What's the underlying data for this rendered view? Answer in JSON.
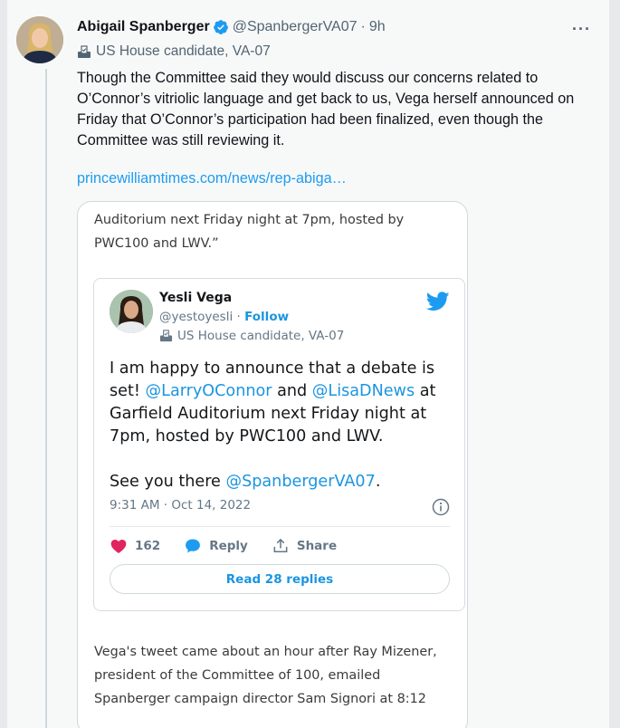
{
  "tweet": {
    "author_name": "Abigail Spanberger",
    "author_handle": "@SpanbergerVA07",
    "time": "9h",
    "label": "US House candidate, VA-07",
    "body": "Though the Committee said they would discuss our concerns related to O’Connor’s vitriolic language and get back to us, Vega herself announced on Friday that O’Connor’s participation had been finalized, even though the Committee was still reviewing it.",
    "link": "princewilliamtimes.com/news/rep-abiga…"
  },
  "article": {
    "top_text": "Auditorium next Friday night at 7pm, hosted by PWC100 and LWV.”",
    "bottom_text": "Vega's tweet came about an hour after Ray Mizener, president of the Committee of 100, emailed Spanberger campaign director Sam Signori at 8:12"
  },
  "embed": {
    "name": "Yesli Vega",
    "handle": "@yestoyesli",
    "follow_label": "Follow",
    "label": "US House candidate, VA-07",
    "text_part1": "I am happy to announce that a debate is set! ",
    "mention1": "@LarryOConnor",
    "text_and": " and ",
    "mention2": "@LisaDNews",
    "text_part2": " at Garfield Auditorium next Friday night at 7pm, hosted by PWC100 and LWV.",
    "text_see": "See you there ",
    "mention3": "@SpanbergerVA07",
    "text_end": ".",
    "timestamp": "9:31 AM · Oct 14, 2022",
    "likes": "162",
    "reply_label": "Reply",
    "share_label": "Share",
    "read_replies": "Read 28 replies"
  },
  "colors": {
    "accent": "#1d9bf0",
    "like": "#e0245e",
    "verified": "#1d9bf0"
  },
  "icons": [
    "verified-icon",
    "ballot-box-icon",
    "more-icon",
    "twitter-bird-icon",
    "info-icon",
    "heart-icon",
    "reply-bubble-icon",
    "share-icon"
  ]
}
